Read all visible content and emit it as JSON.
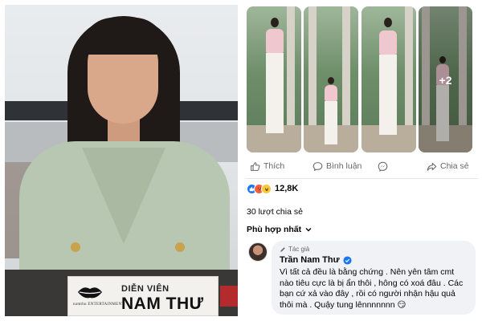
{
  "photo": {
    "card_role": "DIỄN VIÊN",
    "card_name": "NAM THƯ",
    "card_brand": "namthu ENTERTAINMENT"
  },
  "gallery": {
    "more_count": "+2"
  },
  "actions": {
    "like": "Thích",
    "comment": "Bình luận",
    "share": "Chia sẻ"
  },
  "reactions": {
    "count": "12,8K",
    "types": [
      "like-icon",
      "angry-icon",
      "haha-icon"
    ]
  },
  "shares_text": "30 lượt chia sẻ",
  "sort_label": "Phù hợp nhất",
  "comment": {
    "badge": "Tác giả",
    "author": "Trần Nam Thư",
    "text": "Vì tất cả đều là bằng chứng . Nên yên tâm cmt nào tiêu cực là bị ẩn thôi , hông có xoá đâu . Các bạn cứ xả vào đây , rồi có người nhận hậu quả thôi mà . Quậy tung lênnnnnnn 😏"
  },
  "colors": {
    "facebook_blue": "#1877f2",
    "icon_gray": "#65676b",
    "bubble_bg": "#f0f2f5"
  }
}
